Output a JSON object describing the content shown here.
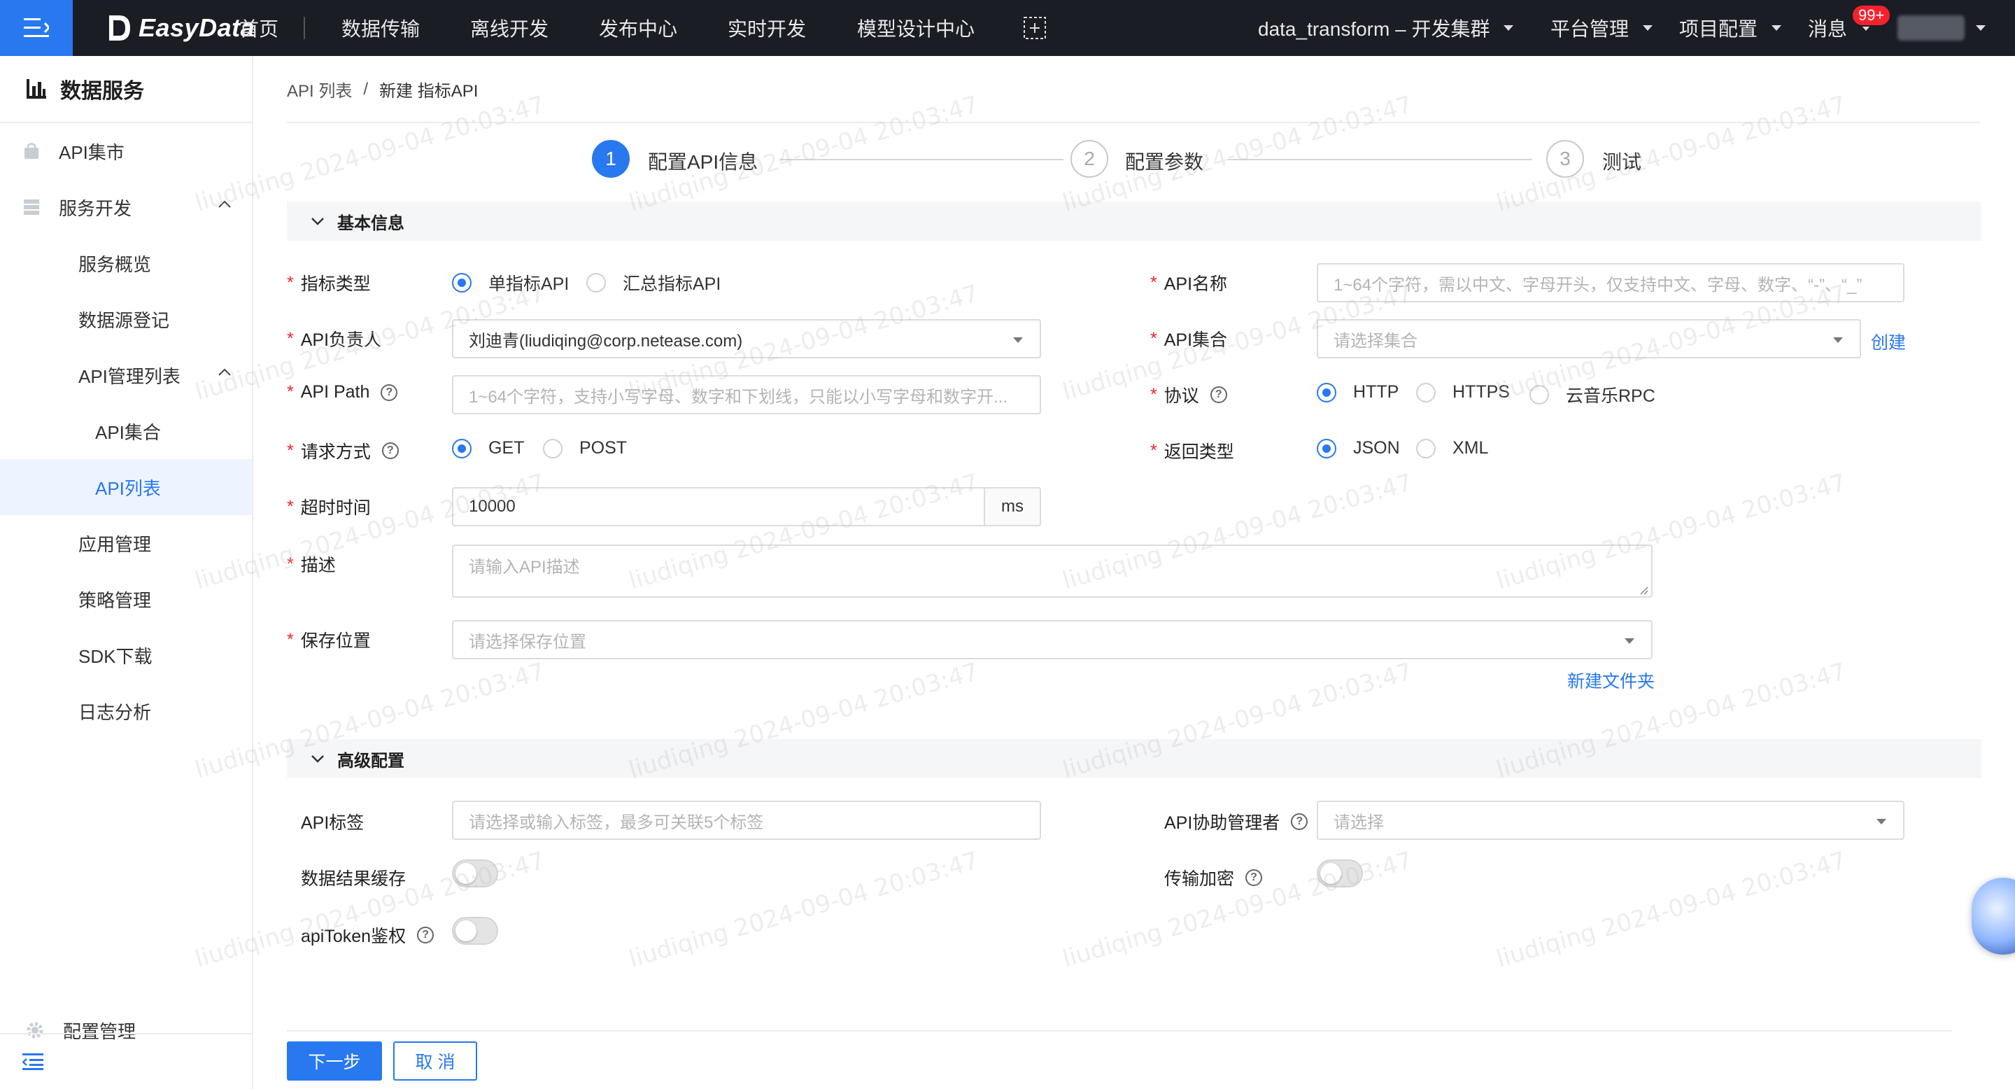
{
  "topbar": {
    "logo_text": "EasyData",
    "nav": [
      "首页",
      "数据传输",
      "离线开发",
      "发布中心",
      "实时开发",
      "模型设计中心"
    ],
    "cluster": "data_transform – 开发集群",
    "platform": "平台管理",
    "project": "项目配置",
    "messages": "消息",
    "badge": "99+"
  },
  "sidebar": {
    "title": "数据服务",
    "items": [
      {
        "label": "API集市"
      },
      {
        "label": "服务开发"
      },
      {
        "label": "服务概览"
      },
      {
        "label": "数据源登记"
      },
      {
        "label": "API管理列表"
      },
      {
        "label": "API集合"
      },
      {
        "label": "API列表"
      },
      {
        "label": "应用管理"
      },
      {
        "label": "策略管理"
      },
      {
        "label": "SDK下载"
      },
      {
        "label": "日志分析"
      }
    ],
    "config": "配置管理"
  },
  "breadcrumb": {
    "parent": "API 列表",
    "sep": "/",
    "current": "新建 指标API"
  },
  "steps": [
    {
      "num": "1",
      "label": "配置API信息"
    },
    {
      "num": "2",
      "label": "配置参数"
    },
    {
      "num": "3",
      "label": "测试"
    }
  ],
  "basic": {
    "section_title": "基本信息",
    "metric_type_label": "指标类型",
    "metric_type_options": [
      "单指标API",
      "汇总指标API"
    ],
    "api_name_label": "API名称",
    "api_name_placeholder": "1~64个字符，需以中文、字母开头，仅支持中文、字母、数字、“-”、“_”",
    "owner_label": "API负责人",
    "owner_value": "刘迪青(liudiqing@corp.netease.com)",
    "collection_label": "API集合",
    "collection_placeholder": "请选择集合",
    "create_link": "创建",
    "path_label": "API Path",
    "path_placeholder": "1~64个字符，支持小写字母、数字和下划线，只能以小写字母和数字开...",
    "protocol_label": "协议",
    "protocol_options": [
      "HTTP",
      "HTTPS",
      "云音乐RPC"
    ],
    "method_label": "请求方式",
    "method_options": [
      "GET",
      "POST"
    ],
    "return_label": "返回类型",
    "return_options": [
      "JSON",
      "XML"
    ],
    "timeout_label": "超时时间",
    "timeout_value": "10000",
    "timeout_unit": "ms",
    "desc_label": "描述",
    "desc_placeholder": "请输入API描述",
    "location_label": "保存位置",
    "location_placeholder": "请选择保存位置",
    "new_folder_link": "新建文件夹"
  },
  "advanced": {
    "section_title": "高级配置",
    "tag_label": "API标签",
    "tag_placeholder": "请选择或输入标签，最多可关联5个标签",
    "co_admin_label": "API协助管理者",
    "co_admin_placeholder": "请选择",
    "cache_label": "数据结果缓存",
    "encrypt_label": "传输加密",
    "token_label": "apiToken鉴权"
  },
  "footer": {
    "next": "下一步",
    "cancel": "取 消"
  },
  "watermark": "liudiqing 2024-09-04 20:03:47",
  "colors": {
    "accent": "#2878f0",
    "topbar": "#1a1d24",
    "required": "#f5222d"
  }
}
